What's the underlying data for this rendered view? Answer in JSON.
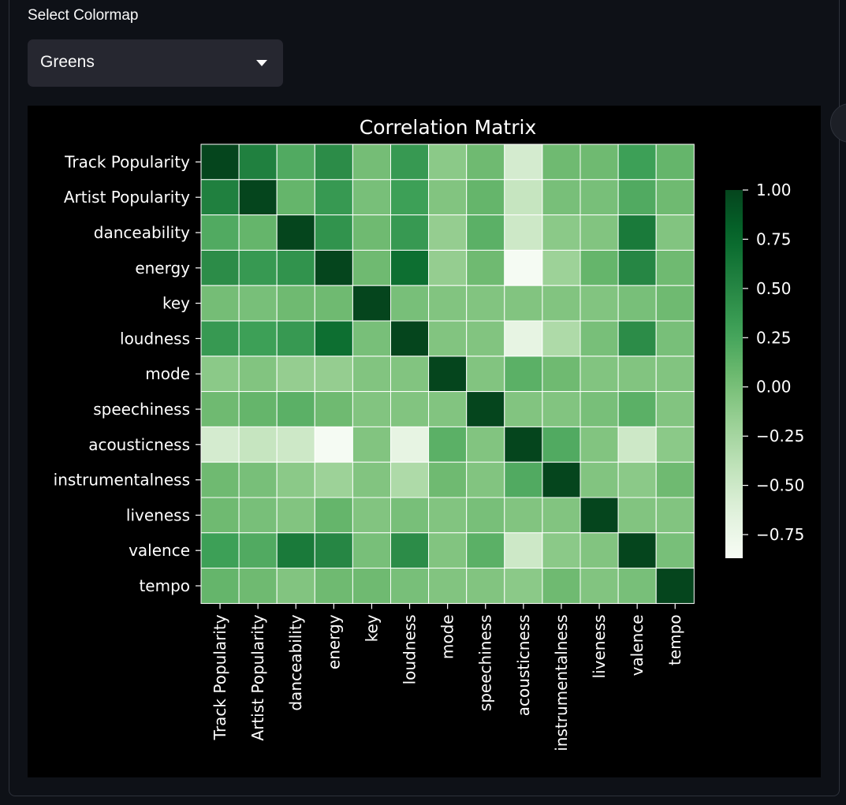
{
  "selector": {
    "label": "Select Colormap",
    "value": "Greens"
  },
  "chart_data": {
    "type": "heatmap",
    "title": "Correlation Matrix",
    "colormap": "Greens",
    "linecolor": "#ffffff",
    "labels": [
      "Track Popularity",
      "Artist Popularity",
      "danceability",
      "energy",
      "key",
      "loudness",
      "mode",
      "speechiness",
      "acousticness",
      "instrumentalness",
      "liveness",
      "valence",
      "tempo"
    ],
    "values": [
      [
        1.0,
        0.55,
        0.2,
        0.45,
        0.02,
        0.35,
        -0.1,
        0.05,
        -0.55,
        0.05,
        0.05,
        0.3,
        0.1
      ],
      [
        0.55,
        1.0,
        0.1,
        0.35,
        0.0,
        0.3,
        -0.05,
        0.1,
        -0.45,
        0.0,
        0.0,
        0.2,
        0.05
      ],
      [
        0.2,
        0.1,
        1.0,
        0.4,
        0.05,
        0.35,
        -0.15,
        0.15,
        -0.5,
        -0.1,
        -0.05,
        0.6,
        -0.05
      ],
      [
        0.45,
        0.35,
        0.4,
        1.0,
        0.05,
        0.7,
        -0.15,
        0.05,
        -0.85,
        -0.2,
        0.1,
        0.5,
        0.05
      ],
      [
        0.02,
        0.0,
        0.05,
        0.05,
        1.0,
        0.0,
        -0.05,
        -0.05,
        -0.05,
        -0.05,
        -0.05,
        0.0,
        0.05
      ],
      [
        0.35,
        0.3,
        0.35,
        0.7,
        0.0,
        1.0,
        -0.05,
        -0.05,
        -0.7,
        -0.3,
        0.0,
        0.45,
        0.0
      ],
      [
        -0.1,
        -0.05,
        -0.15,
        -0.15,
        -0.05,
        -0.05,
        1.0,
        -0.05,
        0.15,
        0.05,
        -0.05,
        -0.05,
        -0.05
      ],
      [
        0.05,
        0.1,
        0.15,
        0.05,
        -0.05,
        -0.05,
        -0.05,
        1.0,
        -0.05,
        -0.05,
        0.0,
        0.15,
        -0.05
      ],
      [
        -0.55,
        -0.45,
        -0.5,
        -0.85,
        -0.05,
        -0.7,
        0.15,
        -0.05,
        1.0,
        0.2,
        -0.05,
        -0.5,
        -0.1
      ],
      [
        0.05,
        0.0,
        -0.1,
        -0.2,
        -0.05,
        -0.3,
        0.05,
        -0.05,
        0.2,
        1.0,
        -0.05,
        -0.1,
        0.05
      ],
      [
        0.05,
        0.0,
        -0.05,
        0.1,
        -0.05,
        0.0,
        -0.05,
        0.0,
        -0.05,
        -0.05,
        1.0,
        -0.05,
        -0.05
      ],
      [
        0.3,
        0.2,
        0.6,
        0.5,
        0.0,
        0.45,
        -0.05,
        0.15,
        -0.5,
        -0.1,
        -0.05,
        1.0,
        0.0
      ],
      [
        0.1,
        0.05,
        -0.05,
        0.05,
        0.05,
        0.0,
        -0.05,
        -0.05,
        -0.1,
        0.05,
        -0.05,
        0.0,
        1.0
      ]
    ],
    "vmin": -0.87,
    "vmax": 1.0,
    "colorbar_ticks": [
      1.0,
      0.75,
      0.5,
      0.25,
      0.0,
      -0.25,
      -0.5,
      -0.75
    ],
    "colorbar_tick_labels": [
      "1.00",
      "0.75",
      "0.50",
      "0.25",
      "0.00",
      "−0.25",
      "−0.50",
      "−0.75"
    ]
  }
}
